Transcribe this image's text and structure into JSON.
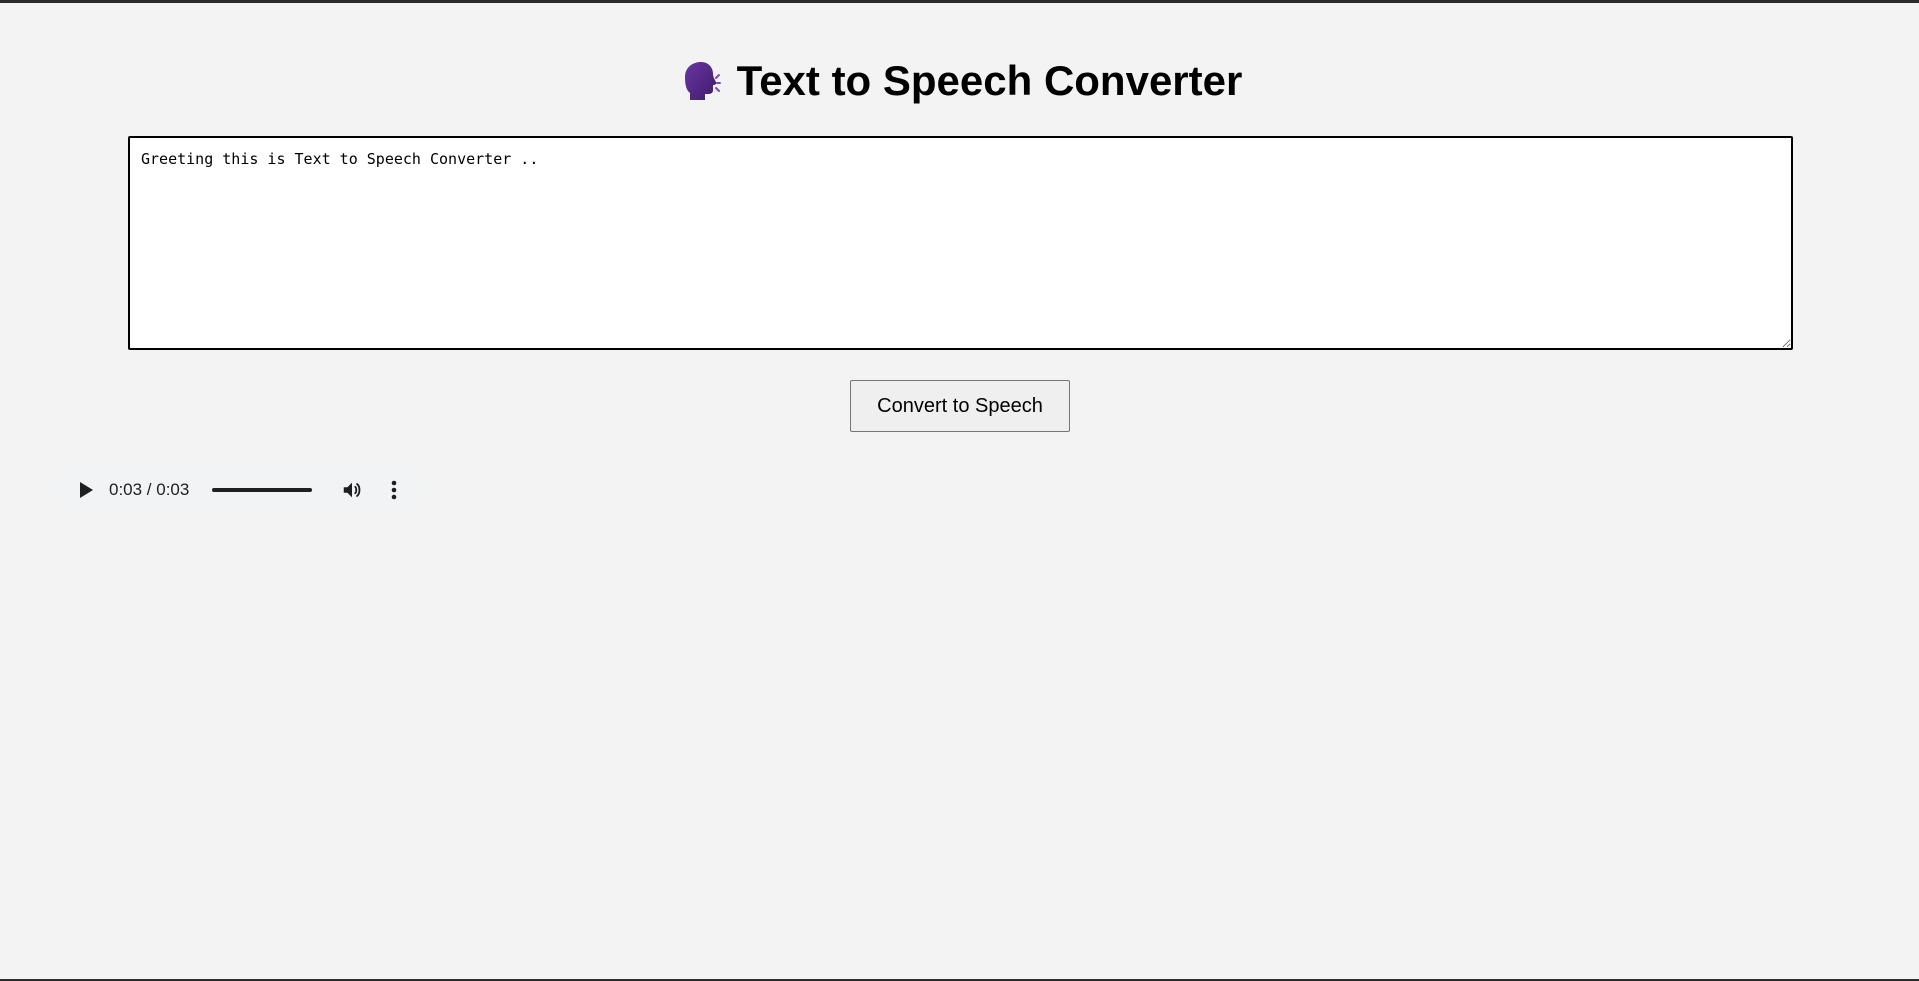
{
  "page": {
    "title": "Text to Speech Converter",
    "title_icon": "speaking-head-icon"
  },
  "input": {
    "value": "Greeting this is Text to Speech Converter ..",
    "placeholder": ""
  },
  "convert_button": {
    "label": "Convert to Speech"
  },
  "audio": {
    "current_time": "0:03",
    "duration": "0:03",
    "time_display": "0:03 / 0:03",
    "progress_fraction": 1.0,
    "play_icon": "play-icon",
    "volume_icon": "volume-icon",
    "more_icon": "more-vertical-icon"
  },
  "colors": {
    "background": "#f3f3f3",
    "icon_purple": "#5b2a8c",
    "player_background": "#f1f3f4"
  }
}
